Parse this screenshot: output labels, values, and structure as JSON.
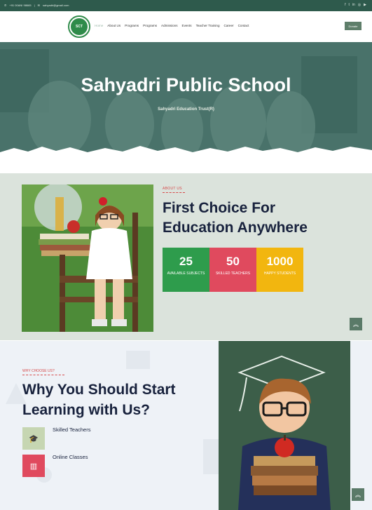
{
  "topbar": {
    "phone": "+91 00ANI 98665",
    "email": "sahyadri@gmail.com",
    "socials": [
      "f",
      "t",
      "in",
      "◎",
      "▶"
    ]
  },
  "nav": {
    "logo_text": "SCT",
    "items": [
      "Home",
      "About Us",
      "Programs",
      "Programs",
      "Admissions",
      "Events",
      "Teacher Training",
      "Career",
      "Contact"
    ],
    "donate": "Donate"
  },
  "hero": {
    "title": "Sahyadri Public School",
    "subtitle": "Sahyadri Education Trust(R)"
  },
  "about": {
    "label": "ABOUT US",
    "title": "First Choice For Education Anywhere",
    "stats": [
      {
        "value": "25",
        "label": "AVAILABLE SUBJECTS",
        "color": "#2e9c4c"
      },
      {
        "value": "50",
        "label": "SKILLED TEACHERS",
        "color": "#e04a5e"
      },
      {
        "value": "1000",
        "label": "HAPPY STUDENTS",
        "color": "#f2b60f"
      }
    ]
  },
  "why": {
    "label": "WHY CHOOSE US?",
    "title": "Why You Should Start Learning with Us?",
    "features": [
      {
        "text": "Skilled Teachers",
        "icon": "graduation-cap-icon",
        "color": "#c6d6b2"
      },
      {
        "text": "Online Classes",
        "icon": "book-icon",
        "color": "#e04a5e"
      }
    ]
  },
  "colors": {
    "primary": "#2e5a4c",
    "dark_text": "#18223d",
    "accent_red": "#d64a4a"
  }
}
